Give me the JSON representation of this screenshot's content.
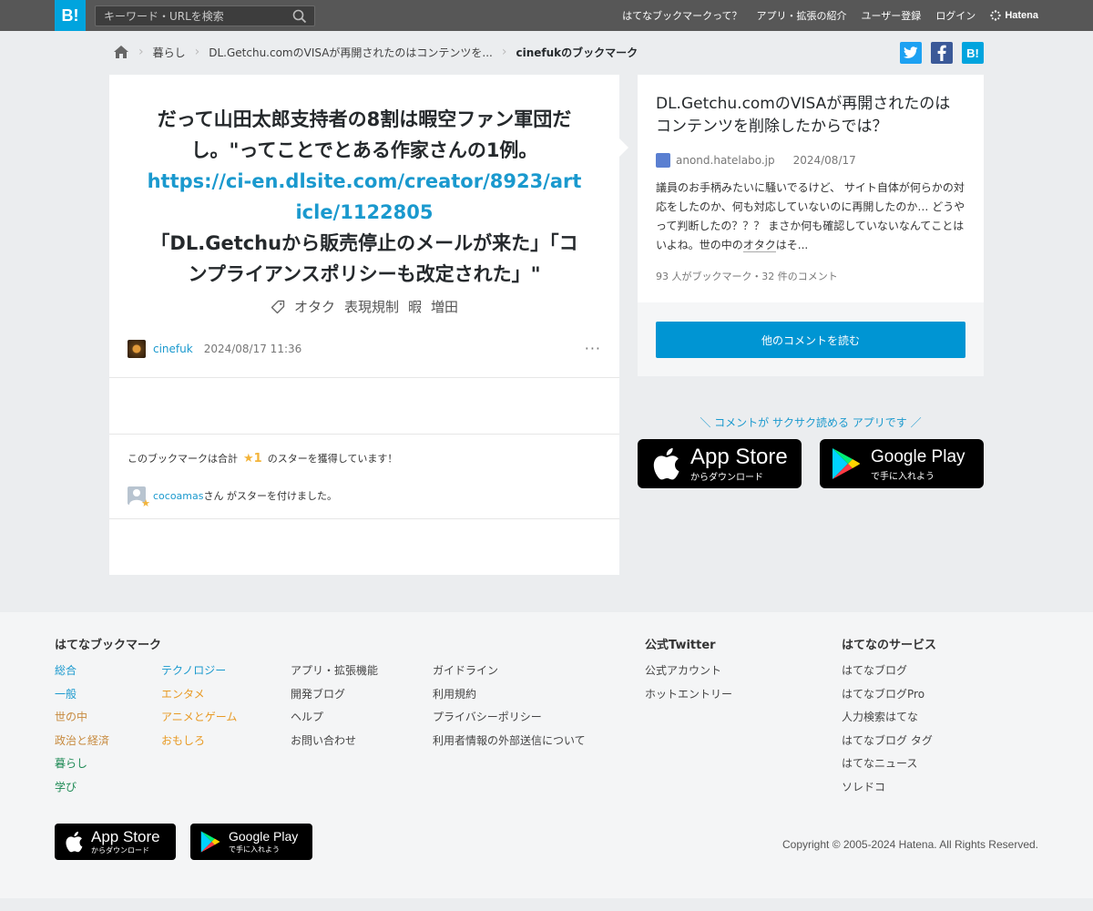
{
  "header": {
    "logo": "B!",
    "search_placeholder": "キーワード・URLを検索",
    "nav": [
      "はてなブックマークって？",
      "アプリ・拡張の紹介",
      "ユーザー登録",
      "ログイン"
    ],
    "brand": "Hatena"
  },
  "breadcrumb": {
    "items": [
      "暮らし",
      "DL.Getchu.comのVISAが再開されたのはコンテンツを..."
    ],
    "current": "cinefukのブックマーク"
  },
  "share": {
    "twitter_icon": "twitter-icon",
    "facebook_icon": "facebook-icon",
    "hatena_label": "B!"
  },
  "bookmark": {
    "text_line1": "だって山田太郎支持者の8割は暇空ファン軍団だし。\"ってことでとある作家さんの1例。",
    "link": "https://ci-en.dlsite.com/creator/8923/article/1122805",
    "text_line2": "「DL.Getchuから販売停止のメールが来た」「コンプライアンスポリシーも改定された」\"",
    "tags": [
      "オタク",
      "表現規制",
      "暇",
      "増田"
    ],
    "user": "cinefuk",
    "datetime": "2024/08/17 11:36",
    "more": "···"
  },
  "stars": {
    "prefix": "このブックマークは合計",
    "count": "★1",
    "suffix": "のスターを獲得しています！",
    "star_user": "cocoamas",
    "star_user_suffix": "さん がスターを付けました。"
  },
  "entry": {
    "title": "DL.Getchu.comのVISAが再開されたのはコンテンツを削除したからでは？",
    "site": "anond.hatelabo.jp",
    "date": "2024/08/17",
    "summary_before": "議員のお手柄みたいに騒いでるけど、 サイト自体が何らかの対応をしたのか、何も対応していないのに再開したのか… どうやって判断したの？？？ まさか何も確認していないなんてことはいよね。世の中の",
    "summary_keyword": "オタク",
    "summary_after": "はそ...",
    "count": "93 人がブックマーク・32 件のコメント",
    "button": "他のコメントを読む"
  },
  "app_promo": {
    "text": "＼ コメントが サクサク読める アプリです ／",
    "appstore_big": "App Store",
    "appstore_small": "からダウンロード",
    "googleplay_big": "Google Play",
    "googleplay_small": "で手に入れよう"
  },
  "footer": {
    "col1_head": "はてなブックマーク",
    "col1a": [
      "総合",
      "一般",
      "世の中",
      "政治と経済",
      "暮らし",
      "学び"
    ],
    "col1a_colors": [
      "#1a99ce",
      "#1a99ce",
      "#c78a3e",
      "#c78a3e",
      "#1e8a55",
      "#1e8a55"
    ],
    "col1b": [
      "テクノロジー",
      "エンタメ",
      "アニメとゲーム",
      "おもしろ"
    ],
    "col1b_colors": [
      "#1a99ce",
      "#e89a25",
      "#e89a25",
      "#e89a25"
    ],
    "col1c": [
      "アプリ・拡張機能",
      "開発ブログ",
      "ヘルプ",
      "お問い合わせ"
    ],
    "col1d": [
      "ガイドライン",
      "利用規約",
      "プライバシーポリシー",
      "利用者情報の外部送信について"
    ],
    "col2_head": "公式Twitter",
    "col2": [
      "公式アカウント",
      "ホットエントリー"
    ],
    "col3_head": "はてなのサービス",
    "col3": [
      "はてなブログ",
      "はてなブログPro",
      "人力検索はてな",
      "はてなブログ タグ",
      "はてなニュース",
      "ソレドコ"
    ],
    "copyright": "Copyright © 2005-2024 Hatena. All Rights Reserved."
  }
}
